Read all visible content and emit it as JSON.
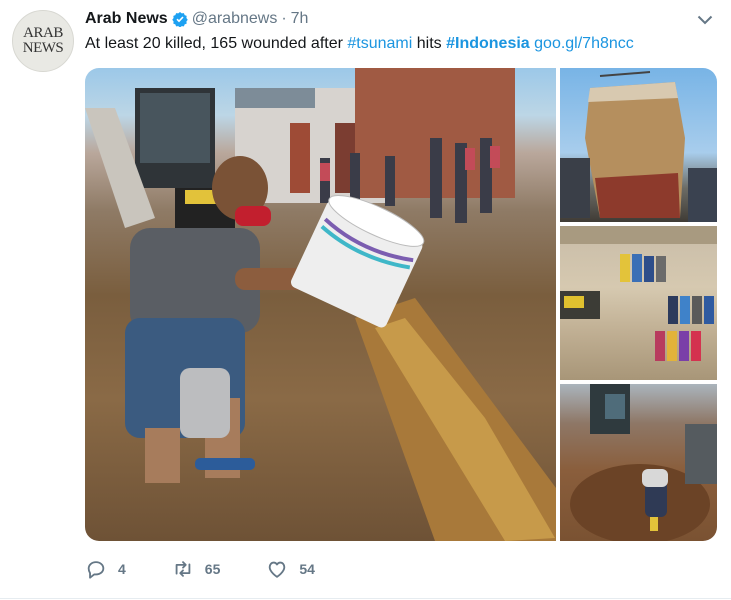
{
  "account": {
    "logo_line1": "ARAB",
    "logo_line2": "NEWS",
    "name": "Arab News",
    "handle": "@arabnews",
    "separator": "·",
    "time": "7h"
  },
  "tweet": {
    "text_prefix": "At least 20 killed, 165 wounded after ",
    "hashtag_tsunami": "#tsunami",
    "text_middle": " hits ",
    "hashtag_indonesia": "#Indonesia",
    "link": "goo.gl/7h8ncc"
  },
  "actions": {
    "replies": "4",
    "retweets": "65",
    "likes": "54"
  },
  "icons": {
    "verified": "verified-badge-icon",
    "caret": "chevron-down-icon",
    "reply": "reply-icon",
    "retweet": "retweet-icon",
    "like": "heart-icon"
  },
  "colors": {
    "link": "#1b95e0",
    "verified": "#1da1f2",
    "muted": "#657786",
    "text": "#14171a"
  }
}
